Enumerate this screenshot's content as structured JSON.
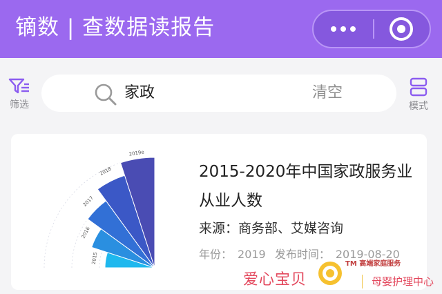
{
  "appbar": {
    "title": "镝数 | 查数据读报告",
    "more_icon": "more-dots-icon",
    "close_icon": "target-close-icon",
    "bg_color": "#9b69ef"
  },
  "search": {
    "filter_label": "筛选",
    "query": "家政",
    "clear_label": "清空",
    "mode_label": "模式"
  },
  "results": [
    {
      "title": "2015-2020年中国家政服务业从业人数",
      "source": "来源：商务部、艾媒咨询",
      "year_label": "年份：",
      "year": "2019",
      "published_label": "发布时间：",
      "published": "2019-08-20",
      "thumbnail": {
        "years": [
          "2015",
          "2016",
          "2017",
          "2018",
          "2019e"
        ],
        "values": [
          0.45,
          0.6,
          0.75,
          0.88,
          1.0
        ],
        "colors": [
          "#1fb8ee",
          "#2a8fe0",
          "#3270d6",
          "#3b58c6",
          "#4a4cb3"
        ]
      }
    }
  ],
  "watermark": {
    "brand": "爱心宝贝",
    "tm_text": "TM 高端家庭服务",
    "tagline": "母婴护理中心"
  }
}
